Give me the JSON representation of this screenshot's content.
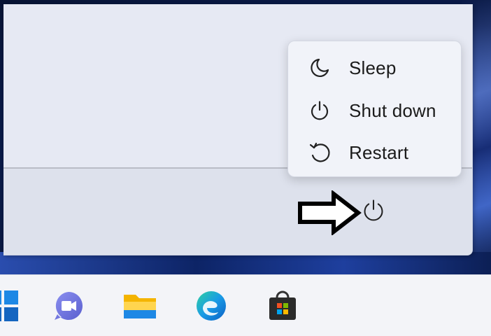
{
  "power_menu": {
    "items": [
      {
        "label": "Sleep",
        "icon": "moon-icon"
      },
      {
        "label": "Shut down",
        "icon": "power-icon"
      },
      {
        "label": "Restart",
        "icon": "restart-icon"
      }
    ]
  },
  "power_button": {
    "icon": "power-icon"
  },
  "taskbar": {
    "items": [
      {
        "name": "Start",
        "icon": "windows-logo-icon"
      },
      {
        "name": "Chat",
        "icon": "teams-chat-icon"
      },
      {
        "name": "File Explorer",
        "icon": "folder-icon"
      },
      {
        "name": "Microsoft Edge",
        "icon": "edge-icon"
      },
      {
        "name": "Microsoft Store",
        "icon": "store-bag-icon"
      }
    ]
  },
  "colors": {
    "accent_blue": "#1f6fd1",
    "flyout_bg": "#f1f3f9",
    "text": "#1b1b1b"
  }
}
